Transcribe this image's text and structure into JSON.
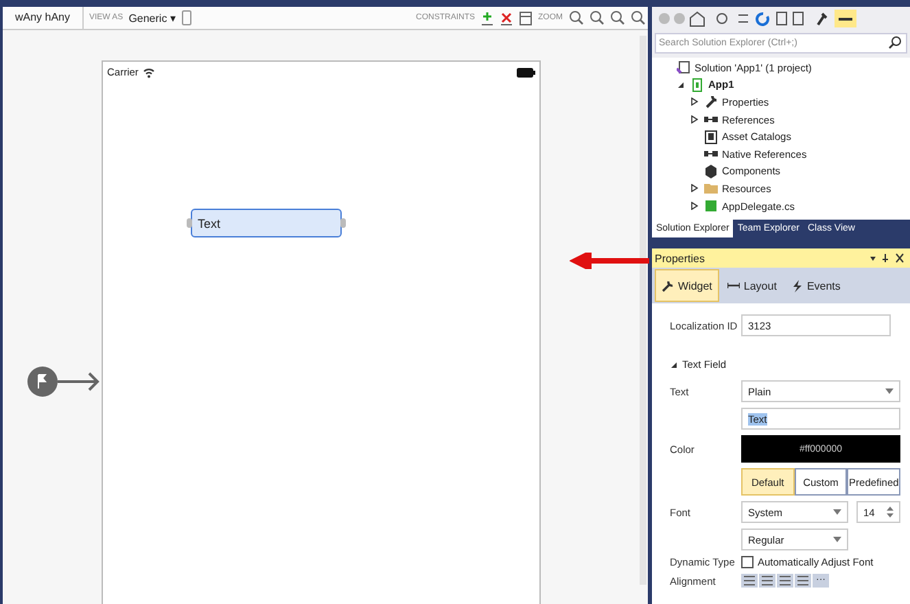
{
  "designer_toolbar": {
    "size_class": "wAny hAny",
    "view_as_label": "VIEW AS",
    "view_as": "Generic ▾",
    "constraints_label": "CONSTRAINTS",
    "zoom_label": "ZOOM"
  },
  "phone": {
    "carrier": "Carrier",
    "text_field": "Text"
  },
  "solution_explorer": {
    "search": {
      "placeholder": "Search Solution Explorer (Ctrl+;)"
    },
    "tree": [
      {
        "label": "Solution 'App1' (1 project)",
        "kind": "solution",
        "children": [
          {
            "label": "App1",
            "kind": "project",
            "expanded": true,
            "children": [
              {
                "label": "Properties",
                "kind": "wrench",
                "expanded": false
              },
              {
                "label": "References",
                "kind": "references",
                "expanded": false
              },
              {
                "label": "Asset Catalogs",
                "kind": "catalog"
              },
              {
                "label": "Native References",
                "kind": "references"
              },
              {
                "label": "Components",
                "kind": "component"
              },
              {
                "label": "Resources",
                "kind": "folder",
                "expanded": false
              },
              {
                "label": "AppDelegate.cs",
                "kind": "file",
                "expanded": false
              }
            ]
          }
        ]
      }
    ],
    "tabs": [
      {
        "label": "Solution Explorer",
        "selected": true
      },
      {
        "label": "Team Explorer",
        "selected": false
      },
      {
        "label": "Class View",
        "selected": false
      }
    ]
  },
  "properties": {
    "title": "Properties",
    "tabs": [
      {
        "label": "Widget",
        "kind": "wrench",
        "selected": true
      },
      {
        "label": "Layout",
        "kind": "layout",
        "selected": false
      },
      {
        "label": "Events",
        "kind": "bolt",
        "selected": false
      }
    ],
    "localization_id": {
      "label": "Localization ID",
      "value": "3123"
    },
    "section": {
      "label": "Text Field",
      "expanded": true
    },
    "text": {
      "label": "Text",
      "type": "Plain",
      "value": "Text"
    },
    "color": {
      "label": "Color",
      "value": "#ff000000"
    },
    "color_modes": [
      {
        "label": "Default",
        "selected": true
      },
      {
        "label": "Custom",
        "selected": false
      },
      {
        "label": "Predefined",
        "selected": false
      }
    ],
    "font": {
      "label": "Font",
      "family": "System",
      "size": "14",
      "weight": "Regular"
    },
    "dynamic_type": {
      "label": "Dynamic Type",
      "option": "Automatically Adjust Font",
      "checked": false
    },
    "alignment": {
      "label": "Alignment",
      "more": "···"
    }
  }
}
